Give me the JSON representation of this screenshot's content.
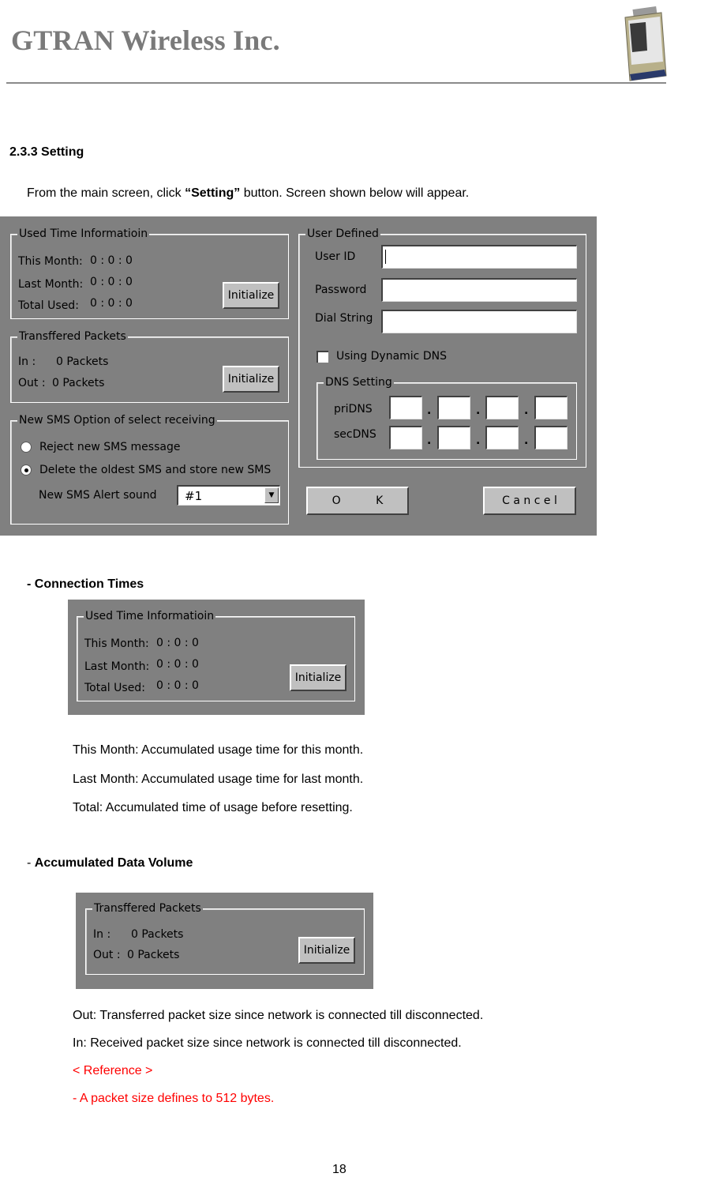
{
  "header": {
    "company": "GTRAN Wireless Inc.",
    "product_image": "pc-card-modem-image"
  },
  "section": {
    "heading": "2.3.3 Setting",
    "intro_before": "From the main screen, click ",
    "intro_bold": "“Setting”",
    "intro_after": " button. Screen shown below will appear."
  },
  "dialog": {
    "used_time": {
      "title": "Used Time Informatioin",
      "rows": [
        {
          "label": "This Month:",
          "value": "0 : 0 : 0"
        },
        {
          "label": "Last Month:",
          "value": "0 : 0 : 0"
        },
        {
          "label": "Total Used:",
          "value": "0 : 0 : 0"
        }
      ],
      "button": "Initialize"
    },
    "packets": {
      "title": "Transffered Packets",
      "in_label": "In :",
      "in_value": "0 Packets",
      "out_label": "Out :",
      "out_value": "0 Packets",
      "button": "Initialize"
    },
    "sms": {
      "title": "New SMS Option of select receiving",
      "options": [
        {
          "label": "Reject new SMS message",
          "selected": false
        },
        {
          "label": "Delete the oldest SMS and store new SMS",
          "selected": true
        }
      ],
      "alert_label": "New SMS Alert sound",
      "alert_value": "#1"
    },
    "user_defined": {
      "title": "User Defined",
      "user_id_label": "User ID",
      "user_id_value": "",
      "password_label": "Password",
      "password_value": "",
      "dial_label": "Dial String",
      "dial_value": "",
      "dynamic_dns_label": "Using Dynamic DNS",
      "dynamic_dns_checked": false
    },
    "dns": {
      "title": "DNS Setting",
      "pri_label": "priDNS",
      "sec_label": "secDNS",
      "pri_values": [
        "",
        "",
        "",
        ""
      ],
      "sec_values": [
        "",
        "",
        "",
        ""
      ],
      "separator": "."
    },
    "ok_label": "O          K",
    "cancel_label": "C a n c e l"
  },
  "connection_times": {
    "heading": "- Connection Times",
    "descriptions": [
      "This Month: Accumulated usage time for this month.",
      "Last Month: Accumulated usage time for last month.",
      "Total: Accumulated time of usage before resetting."
    ]
  },
  "data_volume": {
    "heading_prefix": "- ",
    "heading": "Accumulated Data Volume",
    "descriptions": [
      "Out: Transferred packet size since network is connected till disconnected.",
      "In: Received packet size since network is connected till disconnected."
    ],
    "reference_title": "< Reference >",
    "reference_note": "- A packet size defines to 512 bytes.",
    "reference_color": "#ff0000"
  },
  "footer": {
    "page_number": "18"
  }
}
